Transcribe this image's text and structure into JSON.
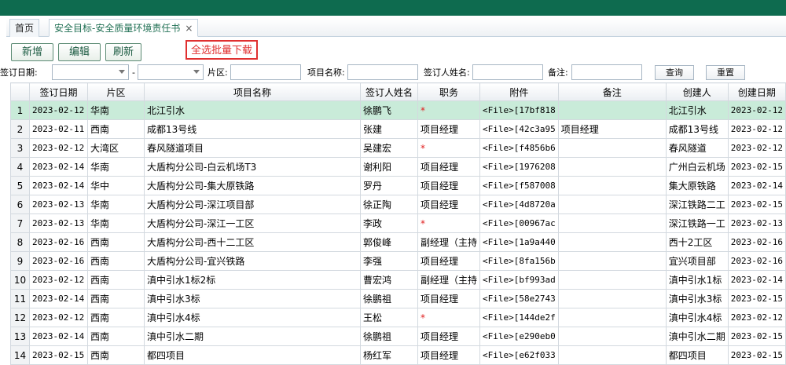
{
  "tabs": {
    "home": "首页",
    "active": "安全目标-安全质量环境责任书",
    "close": "×"
  },
  "toolbar": {
    "add": "新增",
    "edit": "编辑",
    "refresh": "刷新",
    "batch_download": "全选批量下载"
  },
  "filters": {
    "sign_date_label": "签订日期:",
    "dash": "-",
    "region_label": "片区:",
    "project_label": "项目名称:",
    "signer_label": "签订人姓名:",
    "remark_label": "备注:",
    "query": "查询",
    "reset": "重置"
  },
  "columns": [
    "签订日期",
    "片区",
    "项目名称",
    "签订人姓名",
    "职务",
    "附件",
    "备注",
    "创建人",
    "创建日期"
  ],
  "rows": [
    {
      "n": "1",
      "date": "2023-02-12",
      "region": "华南",
      "project": "北江引水",
      "signer": "徐鹏飞",
      "title": "*",
      "file": "<File>[17bf818",
      "remark": "",
      "creator": "北江引水",
      "created": "2023-02-12"
    },
    {
      "n": "2",
      "date": "2023-02-11",
      "region": "西南",
      "project": "成都13号线",
      "signer": "张建",
      "title": "项目经理",
      "file": "<File>[42c3a95",
      "remark": "项目经理",
      "creator": "成都13号线",
      "created": "2023-02-12"
    },
    {
      "n": "3",
      "date": "2023-02-12",
      "region": "大湾区",
      "project": "春风隧道项目",
      "signer": "吴建宏",
      "title": "*",
      "file": "<File>[f4856b6",
      "remark": "",
      "creator": "春风隧道",
      "created": "2023-02-12"
    },
    {
      "n": "4",
      "date": "2023-02-14",
      "region": "华南",
      "project": "大盾构分公司-白云机场T3",
      "signer": "谢利阳",
      "title": "项目经理",
      "file": "<File>[1976208",
      "remark": "",
      "creator": "广州白云机场",
      "created": "2023-02-15"
    },
    {
      "n": "5",
      "date": "2023-02-14",
      "region": "华中",
      "project": "大盾构分公司-集大原铁路",
      "signer": "罗丹",
      "title": "项目经理",
      "file": "<File>[f587008",
      "remark": "",
      "creator": "集大原铁路",
      "created": "2023-02-14"
    },
    {
      "n": "6",
      "date": "2023-02-13",
      "region": "华南",
      "project": "大盾构分公司-深江项目部",
      "signer": "徐正陶",
      "title": "项目经理",
      "file": "<File>[4d8720a",
      "remark": "",
      "creator": "深江铁路二工",
      "created": "2023-02-15"
    },
    {
      "n": "7",
      "date": "2023-02-13",
      "region": "华南",
      "project": "大盾构分公司-深江一工区",
      "signer": "李政",
      "title": "*",
      "file": "<File>[00967ac",
      "remark": "",
      "creator": "深江铁路一工",
      "created": "2023-02-13"
    },
    {
      "n": "8",
      "date": "2023-02-16",
      "region": "西南",
      "project": "大盾构分公司-西十二工区",
      "signer": "郭俊峰",
      "title": "副经理（主持",
      "file": "<File>[1a9a440",
      "remark": "",
      "creator": "西十2工区",
      "created": "2023-02-16"
    },
    {
      "n": "9",
      "date": "2023-02-16",
      "region": "西南",
      "project": "大盾构分公司-宜兴铁路",
      "signer": "李强",
      "title": "项目经理",
      "file": "<File>[8fa156b",
      "remark": "",
      "creator": "宜兴项目部",
      "created": "2023-02-16"
    },
    {
      "n": "10",
      "date": "2023-02-12",
      "region": "西南",
      "project": "滇中引水1标2标",
      "signer": "曹宏鸿",
      "title": "副经理（主持",
      "file": "<File>[bf993ad",
      "remark": "",
      "creator": "滇中引水1标",
      "created": "2023-02-14"
    },
    {
      "n": "11",
      "date": "2023-02-14",
      "region": "西南",
      "project": "滇中引水3标",
      "signer": "徐鹏祖",
      "title": "项目经理",
      "file": "<File>[58e2743",
      "remark": "",
      "creator": "滇中引水3标",
      "created": "2023-02-15"
    },
    {
      "n": "12",
      "date": "2023-02-12",
      "region": "西南",
      "project": "滇中引水4标",
      "signer": "王松",
      "title": "*",
      "file": "<File>[144de2f",
      "remark": "",
      "creator": "滇中引水4标",
      "created": "2023-02-12"
    },
    {
      "n": "13",
      "date": "2023-02-14",
      "region": "西南",
      "project": "滇中引水二期",
      "signer": "徐鹏祖",
      "title": "项目经理",
      "file": "<File>[e290eb0",
      "remark": "",
      "creator": "滇中引水二期",
      "created": "2023-02-15"
    },
    {
      "n": "14",
      "date": "2023-02-15",
      "region": "西南",
      "project": "都四项目",
      "signer": "杨红军",
      "title": "项目经理",
      "file": "<File>[e62f033",
      "remark": "",
      "creator": "都四项目",
      "created": "2023-02-15"
    }
  ]
}
